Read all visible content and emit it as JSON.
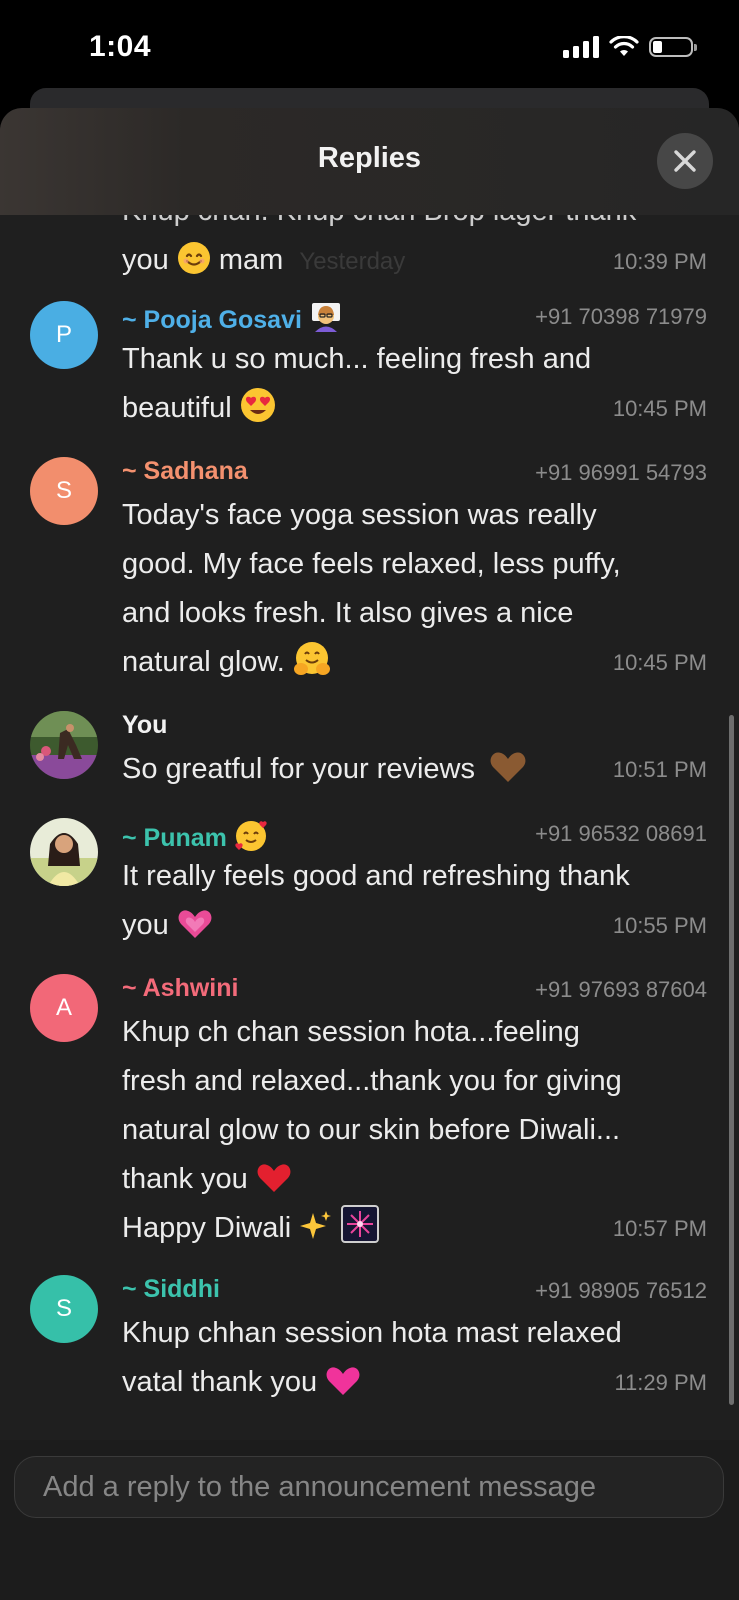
{
  "status_bar": {
    "time": "1:04"
  },
  "sheet": {
    "title": "Replies"
  },
  "messages": [
    {
      "body_line1": "Khup chan. Khup chan Brop lager thank",
      "body_line2": "you",
      "body_line3": "mam",
      "overlay": "Yesterday",
      "time": "10:39 PM"
    },
    {
      "avatar": "P",
      "name": "~ Pooja Gosavi",
      "name_color": "#4fb0e8",
      "avatar_color": "#4aaee3",
      "phone": "+91 70398 71979",
      "body_line1": "Thank u so much... feeling fresh and",
      "body_line2": "beautiful",
      "time": "10:45 PM"
    },
    {
      "avatar": "S",
      "name": "~ Sadhana",
      "name_color": "#f4916f",
      "avatar_color": "#f28e6d",
      "phone": "+91 96991 54793",
      "body_line1": "Today's face yoga session was really",
      "body_line2": "good. My face feels relaxed, less puffy,",
      "body_line3": "and looks fresh. It also gives a nice",
      "body_line4": "natural glow.",
      "time": "10:45 PM"
    },
    {
      "name": "You",
      "name_color": "#f2f2f2",
      "body_line1": "So greatful for your reviews",
      "time": "10:51 PM"
    },
    {
      "name": "~ Punam",
      "name_color": "#3cc3ad",
      "phone": "+91 96532 08691",
      "body_line1": "It really feels good and refreshing thank",
      "body_line2": "you",
      "time": "10:55 PM"
    },
    {
      "avatar": "A",
      "name": "~ Ashwini",
      "name_color": "#f36b7a",
      "avatar_color": "#f26878",
      "phone": "+91 97693 87604",
      "body_line1": "Khup ch chan session hota...feeling",
      "body_line2": "fresh and relaxed...thank you for giving",
      "body_line3": "natural glow to our skin before Diwali...",
      "body_line4": "thank you",
      "body_line5": "Happy Diwali",
      "time": "10:57 PM"
    },
    {
      "avatar": "S",
      "name": "~ Siddhi",
      "name_color": "#3cc3ad",
      "avatar_color": "#36c0a9",
      "phone": "+91 98905 76512",
      "body_line1": "Khup chhan session hota mast relaxed",
      "body_line2": "vatal thank you",
      "time": "11:29 PM"
    }
  ],
  "reply": {
    "placeholder": "Add a reply to the announcement message"
  },
  "icons": [
    "signal-icon",
    "wifi-icon",
    "battery-icon",
    "close-icon",
    "smile-emoji",
    "teacher-emoji",
    "heart-eyes-emoji",
    "hug-emoji",
    "brown-heart-emoji",
    "smiling-hearts-emoji",
    "pink-heart-emoji",
    "red-heart-emoji",
    "sparkles-emoji",
    "fireworks-emoji"
  ],
  "colors": {
    "background": "#1f1f1f",
    "header": "#262626",
    "input_bg": "#232323"
  }
}
